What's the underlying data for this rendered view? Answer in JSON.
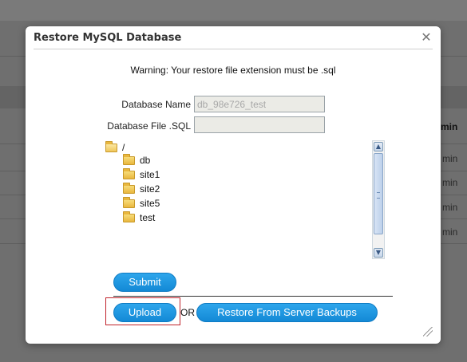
{
  "background": {
    "column_header": "min",
    "cell_text": "min"
  },
  "modal": {
    "title": "Restore MySQL Database",
    "close_icon": "close-icon",
    "warning": "Warning: Your restore file extension must be .sql",
    "database_name": {
      "label": "Database Name",
      "value": "db_98e726_test"
    },
    "database_file": {
      "label": "Database File .SQL",
      "value": ""
    },
    "tree": {
      "root": "/",
      "folders": [
        "db",
        "site1",
        "site2",
        "site5",
        "test"
      ]
    },
    "submit_label": "Submit",
    "upload_label": "Upload",
    "or_text": "OR",
    "restore_label": "Restore From Server Backups"
  },
  "colors": {
    "overlay": "#6f6f6f",
    "button": "#1e97e0",
    "highlight": "#c0232b"
  }
}
